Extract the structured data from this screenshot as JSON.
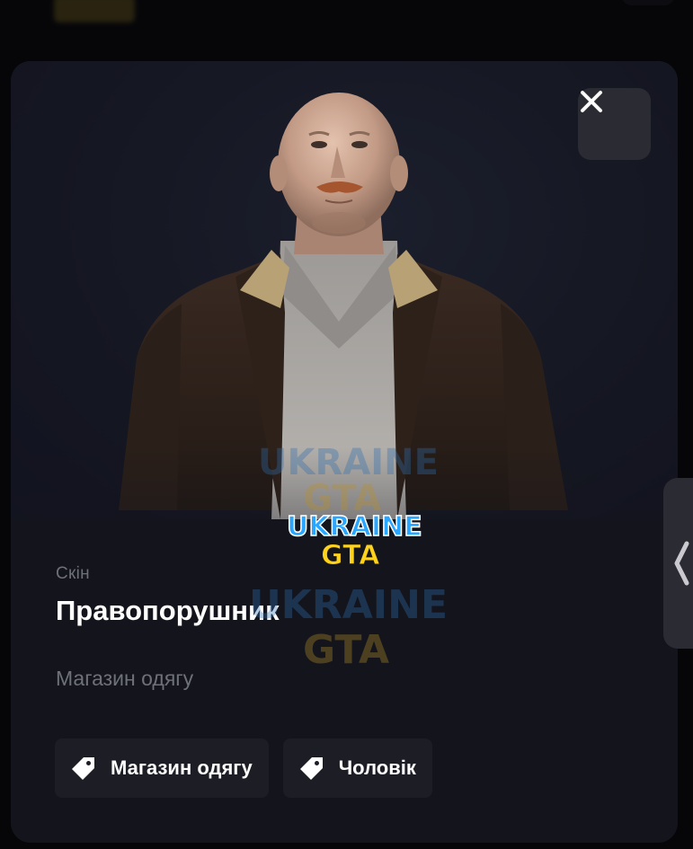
{
  "item": {
    "category": "Скін",
    "name": "Правопорушник",
    "source": "Магазин одягу"
  },
  "tags": [
    {
      "label": "Магазин одягу",
      "icon": "tag-icon"
    },
    {
      "label": "Чоловік",
      "icon": "tag-icon"
    }
  ],
  "icons": {
    "close": "close-icon",
    "side_tab": "chevron-left-icon"
  },
  "colors": {
    "background": "#060609",
    "modal": "#14151c",
    "tag_background": "#1c1d25",
    "close_button": "#2a2b33",
    "muted_text": "#6f7179",
    "text": "#ffffff"
  },
  "watermark": {
    "line1": "UKRAINE",
    "line2": "GTA"
  }
}
